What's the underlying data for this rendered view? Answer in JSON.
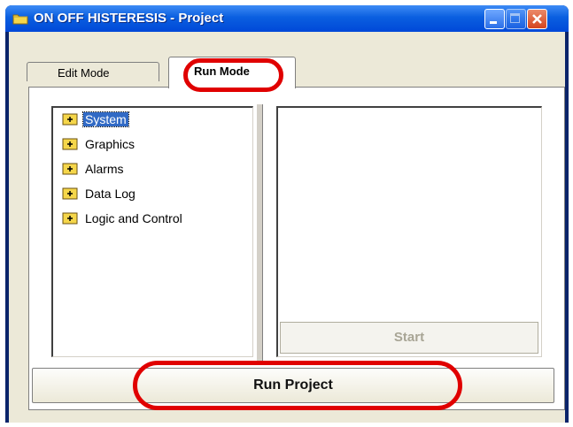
{
  "window": {
    "title": "ON OFF HISTERESIS - Project"
  },
  "icons": {
    "app": "folder-icon",
    "minimize": "minimize-icon",
    "maximize": "maximize-icon",
    "close": "close-icon"
  },
  "tabs": [
    {
      "label": "Edit Mode",
      "active": false
    },
    {
      "label": "Run Mode",
      "active": true
    }
  ],
  "tree": {
    "items": [
      {
        "label": "System",
        "selected": true
      },
      {
        "label": "Graphics",
        "selected": false
      },
      {
        "label": "Alarms",
        "selected": false
      },
      {
        "label": "Data Log",
        "selected": false
      },
      {
        "label": "Logic and Control",
        "selected": false
      }
    ]
  },
  "buttons": {
    "start_label": "Start",
    "run_project_label": "Run Project"
  },
  "colors": {
    "highlight_ring": "#e00000",
    "title_bar": "#0a5fe0",
    "selection": "#316ac5"
  }
}
